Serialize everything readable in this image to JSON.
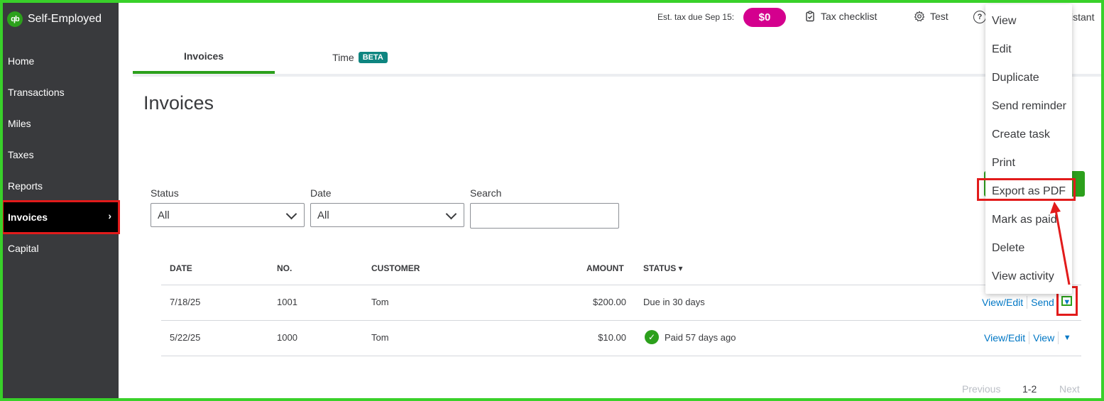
{
  "app": {
    "logo_text": "qb",
    "name": "Self-Employed"
  },
  "sidebar": {
    "items": [
      {
        "label": "Home"
      },
      {
        "label": "Transactions"
      },
      {
        "label": "Miles"
      },
      {
        "label": "Taxes"
      },
      {
        "label": "Reports"
      },
      {
        "label": "Invoices",
        "active": true
      },
      {
        "label": "Capital"
      }
    ],
    "chevron": "›"
  },
  "topbar": {
    "est_tax_label": "Est. tax due Sep 15:",
    "est_tax_amount": "$0",
    "tax_checklist": "Tax checklist",
    "settings_label": "Test",
    "help_icon": "?",
    "assistant_label": "sistant"
  },
  "tabs": {
    "invoices": "Invoices",
    "time": "Time",
    "time_badge": "BETA"
  },
  "page": {
    "title": "Invoices"
  },
  "filters": {
    "status_label": "Status",
    "status_value": "All",
    "date_label": "Date",
    "date_value": "All",
    "search_label": "Search",
    "search_value": ""
  },
  "table": {
    "headers": {
      "date": "DATE",
      "no": "NO.",
      "customer": "CUSTOMER",
      "amount": "AMOUNT",
      "status": "STATUS ▾"
    },
    "rows": [
      {
        "date": "7/18/25",
        "no": "1001",
        "customer": "Tom",
        "amount": "$200.00",
        "status": "Due in 30 days",
        "action_primary": "View/Edit",
        "action_secondary": "Send",
        "caret": "▼"
      },
      {
        "date": "5/22/25",
        "no": "1000",
        "customer": "Tom",
        "amount": "$10.00",
        "status": "Paid 57 days ago",
        "status_icon": "✓",
        "action_primary": "View/Edit",
        "action_secondary": "View",
        "caret": "▼"
      }
    ]
  },
  "pagination": {
    "previous": "Previous",
    "range": "1-2",
    "next": "Next"
  },
  "menu": {
    "items": [
      "View",
      "Edit",
      "Duplicate",
      "Send reminder",
      "Create task",
      "Print",
      "Export as PDF",
      "Mark as paid",
      "Delete",
      "View activity"
    ]
  },
  "colors": {
    "frame_green": "#39d12a",
    "brand_green": "#2ca01c",
    "sidebar_bg": "#393a3d",
    "tax_pill": "#d4008e",
    "beta_teal": "#0e8580",
    "link_blue": "#0077c5",
    "annotation_red": "#e21b1b"
  }
}
